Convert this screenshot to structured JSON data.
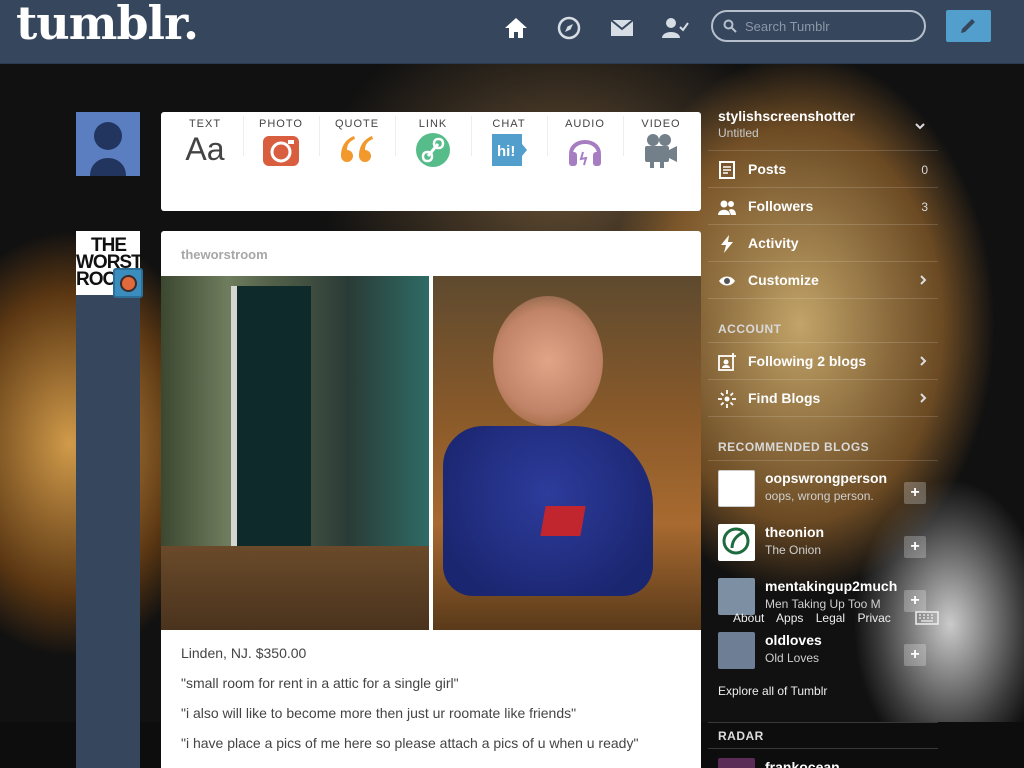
{
  "header": {
    "logo": "tumblr.",
    "search_placeholder": "Search Tumblr",
    "nav": [
      "home-icon",
      "explore-icon",
      "inbox-icon",
      "account-icon"
    ]
  },
  "composer": {
    "types": [
      {
        "label": "TEXT",
        "icon": "text-icon",
        "glyph": "Aa",
        "color": "#444444"
      },
      {
        "label": "PHOTO",
        "icon": "camera-icon",
        "color": "#d95e40"
      },
      {
        "label": "QUOTE",
        "icon": "quote-icon",
        "glyph": "66",
        "color": "#f2992e"
      },
      {
        "label": "LINK",
        "icon": "link-icon",
        "color": "#56bc8a"
      },
      {
        "label": "CHAT",
        "icon": "chat-icon",
        "glyph": "hi!",
        "color": "#529ecc"
      },
      {
        "label": "AUDIO",
        "icon": "headphones-icon",
        "color": "#a77dc2"
      },
      {
        "label": "VIDEO",
        "icon": "video-camera-icon",
        "color": "#748089"
      }
    ]
  },
  "post": {
    "author": "theworstroom",
    "blog_avatar_text": [
      "THE",
      "WORST",
      "ROO"
    ],
    "lines": [
      "Linden, NJ. $350.00",
      "\"small room for rent in a attic for a single girl\"",
      "\"i also will like to become more then just ur roomate like friends\"",
      "\"i have place a pics of me here so please attach a pics of u when u ready\""
    ]
  },
  "sidebar": {
    "blog_name": "stylishscreenshotter",
    "blog_title": "Untitled",
    "menu": [
      {
        "label": "Posts",
        "count": "0",
        "icon": "posts-icon"
      },
      {
        "label": "Followers",
        "count": "3",
        "icon": "followers-icon"
      },
      {
        "label": "Activity",
        "count": "",
        "icon": "activity-icon"
      },
      {
        "label": "Customize",
        "count": "",
        "icon": "eye-icon"
      }
    ],
    "account_heading": "ACCOUNT",
    "account": [
      {
        "label": "Following 2 blogs",
        "icon": "following-icon"
      },
      {
        "label": "Find Blogs",
        "icon": "find-blogs-icon"
      }
    ],
    "recommended_heading": "RECOMMENDED BLOGS",
    "recommended": [
      {
        "name": "oopswrongperson",
        "title": "oops, wrong person.",
        "color": "#ffffff"
      },
      {
        "name": "theonion",
        "title": "The Onion",
        "color": "#1d6b3e"
      },
      {
        "name": "mentakingup2much",
        "title": "Men Taking Up Too M",
        "color": "#7c8fa3"
      },
      {
        "name": "oldloves",
        "title": "Old Loves",
        "color": "#6e7f95"
      }
    ],
    "footer_links": [
      "About",
      "Apps",
      "Legal",
      "Privac"
    ],
    "explore": "Explore all of Tumblr",
    "radar_heading": "RADAR",
    "radar_blog": "frankocean"
  },
  "colors": {
    "header_bg": "#36465d",
    "post_button": "#529ecc"
  }
}
